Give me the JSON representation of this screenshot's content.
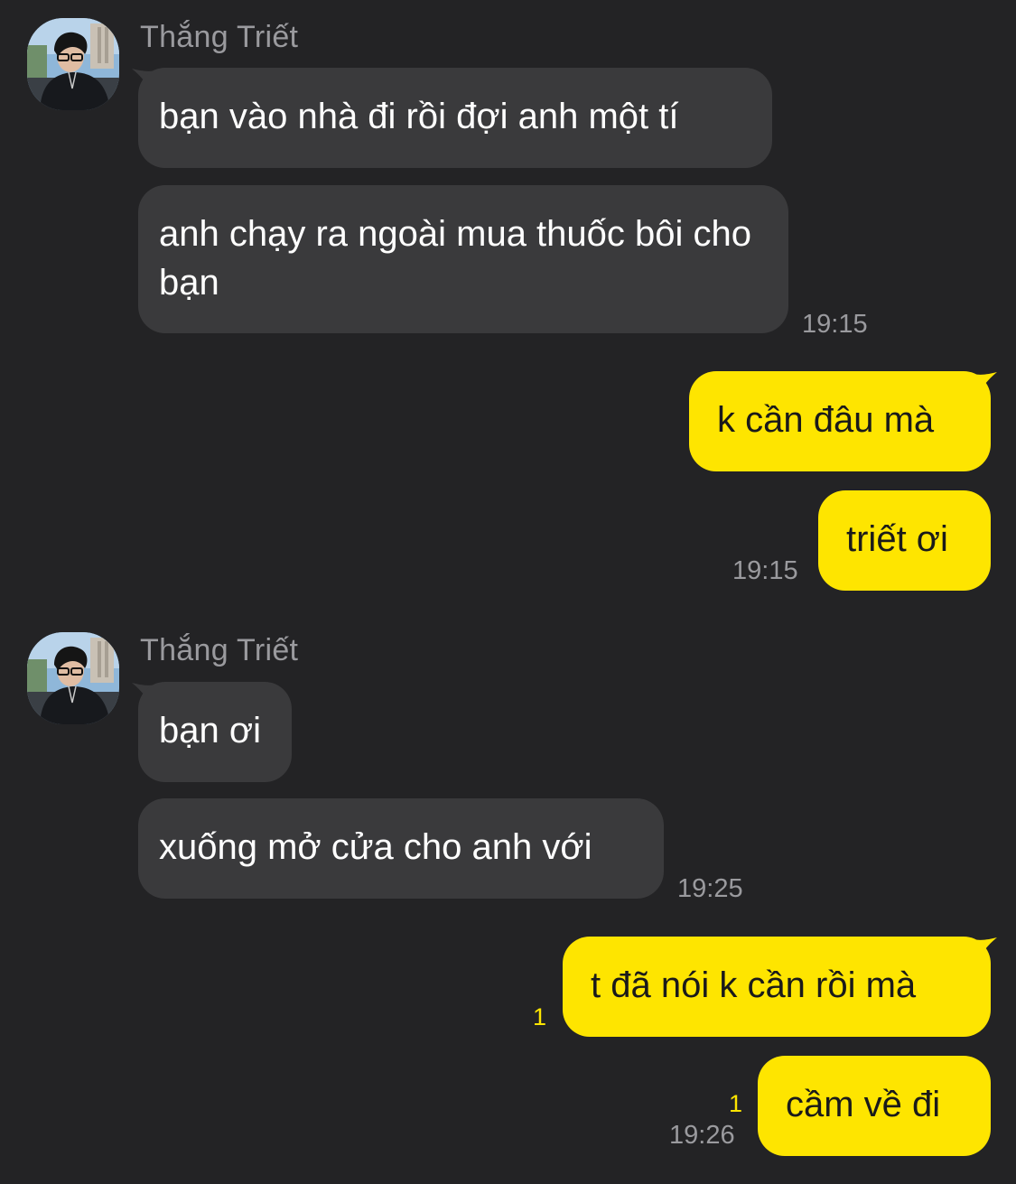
{
  "colors": {
    "background": "#232325",
    "incoming_bubble": "#3a3a3c",
    "outgoing_bubble": "#fee500",
    "meta_text": "#9a9a9e",
    "unread_count": "#fee500"
  },
  "groups": [
    {
      "sender": "Thắng Triết",
      "avatar_icon": "profile-photo",
      "messages": [
        "bạn vào nhà đi rồi đợi anh một tí",
        "anh chạy ra ngoài mua thuốc bôi cho bạn"
      ],
      "time": "19:15"
    },
    {
      "sender": "me",
      "messages": [
        "k cần đâu mà",
        "triết ơi"
      ],
      "time": "19:15"
    },
    {
      "sender": "Thắng Triết",
      "avatar_icon": "profile-photo",
      "messages": [
        "bạn ơi",
        "xuống mở cửa cho anh với"
      ],
      "time": "19:25"
    },
    {
      "sender": "me",
      "messages": [
        "t đã nói k cần rồi mà",
        "cầm về đi"
      ],
      "unread": [
        "1",
        "1"
      ],
      "time": "19:26"
    }
  ]
}
